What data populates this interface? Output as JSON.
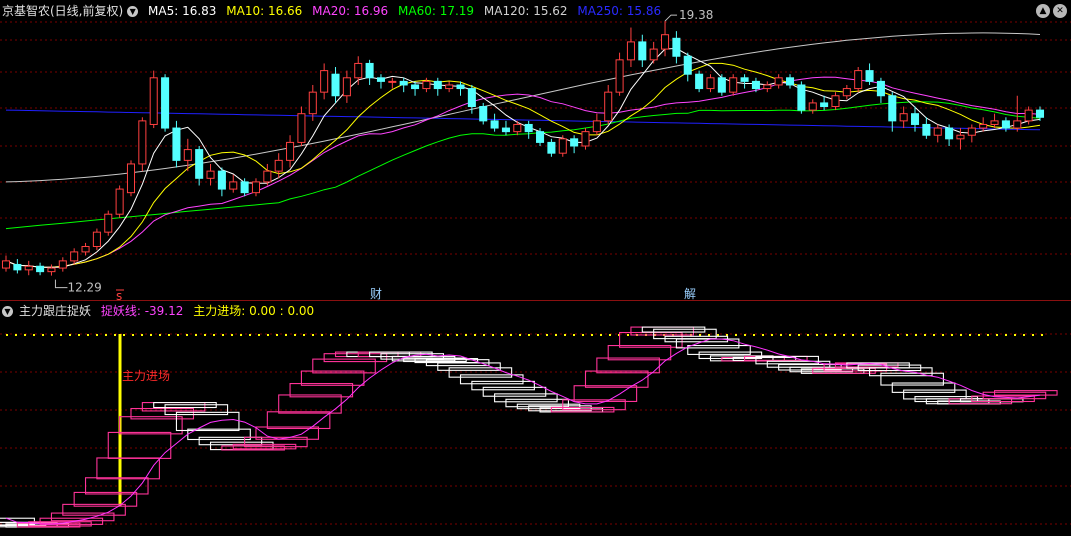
{
  "top_header": {
    "stock_name": "京基智农(日线,前复权)",
    "ma5": "MA5: 16.83",
    "ma10": "MA10: 16.66",
    "ma20": "MA20: 16.96",
    "ma60": "MA60: 17.19",
    "ma120": "MA120: 15.62",
    "ma250": "MA250: 15.86"
  },
  "bottom_header": {
    "indicator_name": "主力跟庄捉妖",
    "line_label": "捉妖线: -39.12",
    "entry_label": "主力进场: 0.00 : 0.00"
  },
  "annotations": {
    "high_label": "19.38",
    "low_label": "12.29",
    "marker_s": "s",
    "marker_cai": "财",
    "marker_jie": "解",
    "entry_text": "主力进场"
  },
  "colors": {
    "up": "#ff4040",
    "down": "#54ffff",
    "ma5": "#ffffff",
    "ma10": "#ffff00",
    "ma20": "#ff44ff",
    "ma60": "#00ff00",
    "ma120": "#c8c8c8",
    "ma250": "#2020ff",
    "pink": "#ff3399",
    "grid": "#7a0000"
  },
  "chart_data": [
    {
      "type": "candlestick",
      "title": "京基智农(日线,前复权)",
      "y_range": [
        12.0,
        19.8
      ],
      "high": 19.38,
      "low": 12.29,
      "candles": [
        [
          12.5,
          12.7,
          12.4,
          12.85
        ],
        [
          12.6,
          12.45,
          12.35,
          12.75
        ],
        [
          12.45,
          12.55,
          12.3,
          12.7
        ],
        [
          12.55,
          12.4,
          12.3,
          12.65
        ],
        [
          12.4,
          12.5,
          12.29,
          12.6
        ],
        [
          12.5,
          12.7,
          12.4,
          12.8
        ],
        [
          12.7,
          12.95,
          12.6,
          13.05
        ],
        [
          12.95,
          13.1,
          12.85,
          13.2
        ],
        [
          13.1,
          13.5,
          13.0,
          13.6
        ],
        [
          13.5,
          14.0,
          13.4,
          14.1
        ],
        [
          14.0,
          14.7,
          13.9,
          14.8
        ],
        [
          14.6,
          15.4,
          14.5,
          15.5
        ],
        [
          15.4,
          16.6,
          15.2,
          16.7
        ],
        [
          16.5,
          17.8,
          16.4,
          18.0
        ],
        [
          17.8,
          16.4,
          16.3,
          17.9
        ],
        [
          16.4,
          15.5,
          15.3,
          16.6
        ],
        [
          15.5,
          15.8,
          15.2,
          16.1
        ],
        [
          15.8,
          15.0,
          14.8,
          15.9
        ],
        [
          15.0,
          15.2,
          14.8,
          15.4
        ],
        [
          15.2,
          14.7,
          14.5,
          15.3
        ],
        [
          14.7,
          14.9,
          14.6,
          15.1
        ],
        [
          14.9,
          14.6,
          14.5,
          15.0
        ],
        [
          14.6,
          14.9,
          14.5,
          15.0
        ],
        [
          14.9,
          15.2,
          14.8,
          15.4
        ],
        [
          15.2,
          15.5,
          15.0,
          15.7
        ],
        [
          15.5,
          16.0,
          15.3,
          16.2
        ],
        [
          16.0,
          16.8,
          15.9,
          17.0
        ],
        [
          16.8,
          17.4,
          16.6,
          17.6
        ],
        [
          17.4,
          18.0,
          17.2,
          18.2
        ],
        [
          17.9,
          17.3,
          17.1,
          18.1
        ],
        [
          17.3,
          17.8,
          17.1,
          18.0
        ],
        [
          17.8,
          18.2,
          17.6,
          18.4
        ],
        [
          18.2,
          17.8,
          17.6,
          18.3
        ],
        [
          17.8,
          17.7,
          17.5,
          17.9
        ],
        [
          17.7,
          17.7,
          17.5,
          17.8
        ],
        [
          17.7,
          17.6,
          17.4,
          17.8
        ],
        [
          17.6,
          17.5,
          17.3,
          17.7
        ],
        [
          17.5,
          17.7,
          17.4,
          17.8
        ],
        [
          17.7,
          17.5,
          17.3,
          17.8
        ],
        [
          17.5,
          17.6,
          17.4,
          17.7
        ],
        [
          17.6,
          17.5,
          17.3,
          17.7
        ],
        [
          17.5,
          17.0,
          16.8,
          17.6
        ],
        [
          17.0,
          16.6,
          16.5,
          17.1
        ],
        [
          16.6,
          16.4,
          16.3,
          16.8
        ],
        [
          16.4,
          16.3,
          16.2,
          16.6
        ],
        [
          16.3,
          16.5,
          16.2,
          16.6
        ],
        [
          16.5,
          16.3,
          16.1,
          16.6
        ],
        [
          16.3,
          16.0,
          15.9,
          16.4
        ],
        [
          16.0,
          15.7,
          15.6,
          16.1
        ],
        [
          15.7,
          16.1,
          15.6,
          16.2
        ],
        [
          16.1,
          15.9,
          15.7,
          16.2
        ],
        [
          15.9,
          16.3,
          15.8,
          16.4
        ],
        [
          16.3,
          16.6,
          16.2,
          16.8
        ],
        [
          16.6,
          17.4,
          16.5,
          17.6
        ],
        [
          17.4,
          18.3,
          17.3,
          18.5
        ],
        [
          18.3,
          18.8,
          18.1,
          19.2
        ],
        [
          18.8,
          18.3,
          18.1,
          19.0
        ],
        [
          18.3,
          18.6,
          18.2,
          18.8
        ],
        [
          18.6,
          19.0,
          18.4,
          19.38
        ],
        [
          18.9,
          18.4,
          18.2,
          19.1
        ],
        [
          18.4,
          17.9,
          17.7,
          18.5
        ],
        [
          17.9,
          17.5,
          17.4,
          18.0
        ],
        [
          17.5,
          17.8,
          17.4,
          17.9
        ],
        [
          17.8,
          17.4,
          17.3,
          17.9
        ],
        [
          17.4,
          17.8,
          17.3,
          17.9
        ],
        [
          17.8,
          17.7,
          17.5,
          17.9
        ],
        [
          17.7,
          17.5,
          17.4,
          17.8
        ],
        [
          17.5,
          17.6,
          17.4,
          17.7
        ],
        [
          17.6,
          17.8,
          17.5,
          17.9
        ],
        [
          17.8,
          17.6,
          17.5,
          17.9
        ],
        [
          17.6,
          16.9,
          16.8,
          17.7
        ],
        [
          16.9,
          17.1,
          16.8,
          17.2
        ],
        [
          17.1,
          17.0,
          16.9,
          17.3
        ],
        [
          17.0,
          17.3,
          16.9,
          17.4
        ],
        [
          17.3,
          17.5,
          17.2,
          17.6
        ],
        [
          17.5,
          18.0,
          17.4,
          18.1
        ],
        [
          18.0,
          17.7,
          17.6,
          18.2
        ],
        [
          17.7,
          17.3,
          17.1,
          17.8
        ],
        [
          17.3,
          16.6,
          16.3,
          17.4
        ],
        [
          16.6,
          16.8,
          16.4,
          17.0
        ],
        [
          16.8,
          16.5,
          16.3,
          17.0
        ],
        [
          16.5,
          16.2,
          16.1,
          16.7
        ],
        [
          16.2,
          16.4,
          16.0,
          16.5
        ],
        [
          16.4,
          16.1,
          15.9,
          16.5
        ],
        [
          16.1,
          16.2,
          15.8,
          16.4
        ],
        [
          16.2,
          16.4,
          16.0,
          16.5
        ],
        [
          16.4,
          16.5,
          16.3,
          16.7
        ],
        [
          16.5,
          16.6,
          16.4,
          16.8
        ],
        [
          16.6,
          16.4,
          16.3,
          16.7
        ],
        [
          16.4,
          16.6,
          16.3,
          17.3
        ],
        [
          16.6,
          16.9,
          16.5,
          17.0
        ],
        [
          16.9,
          16.7,
          16.6,
          17.0
        ]
      ]
    },
    {
      "type": "indicator",
      "title": "主力跟庄捉妖",
      "series": [
        {
          "name": "捉妖线",
          "value": -39.12
        },
        {
          "name": "主力进场",
          "value": 0.0
        }
      ]
    }
  ]
}
